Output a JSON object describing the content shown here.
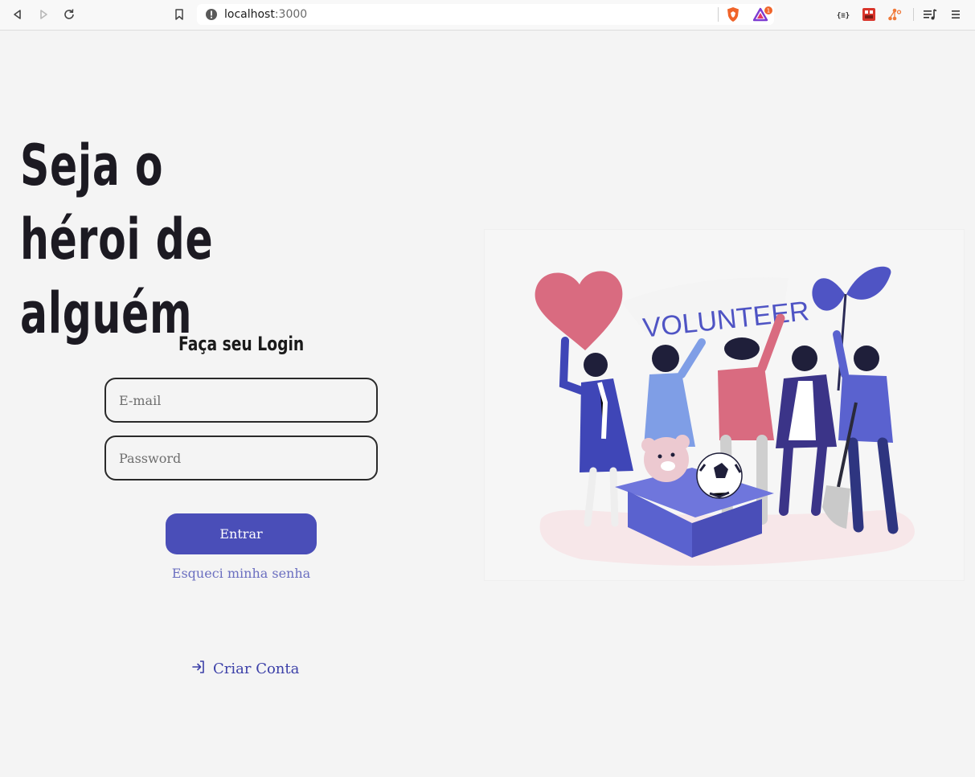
{
  "browser": {
    "url_host": "localhost",
    "url_port": ":3000",
    "notification_badge": "1",
    "icons": [
      "back-icon",
      "forward-icon",
      "reload-icon",
      "bookmark-icon",
      "site-info-icon",
      "brave-shield-icon",
      "brave-rewards-icon",
      "json-viewer-icon",
      "extension-icon",
      "share-icon",
      "playlist-icon",
      "menu-icon"
    ]
  },
  "hero": {
    "title_line1": "Seja o héroi de",
    "title_line2": "alguém"
  },
  "login": {
    "heading": "Faça seu Login",
    "email_placeholder": "E-mail",
    "password_placeholder": "Password",
    "submit_label": "Entrar",
    "forgot_label": "Esqueci minha senha"
  },
  "signup": {
    "label": "Criar Conta"
  },
  "illustration": {
    "banner_text": "VOLUNTEER"
  },
  "colors": {
    "primary": "#4a4eb8",
    "link": "#6b6fc0",
    "heart": "#d96b80",
    "background": "#f4f4f4"
  }
}
